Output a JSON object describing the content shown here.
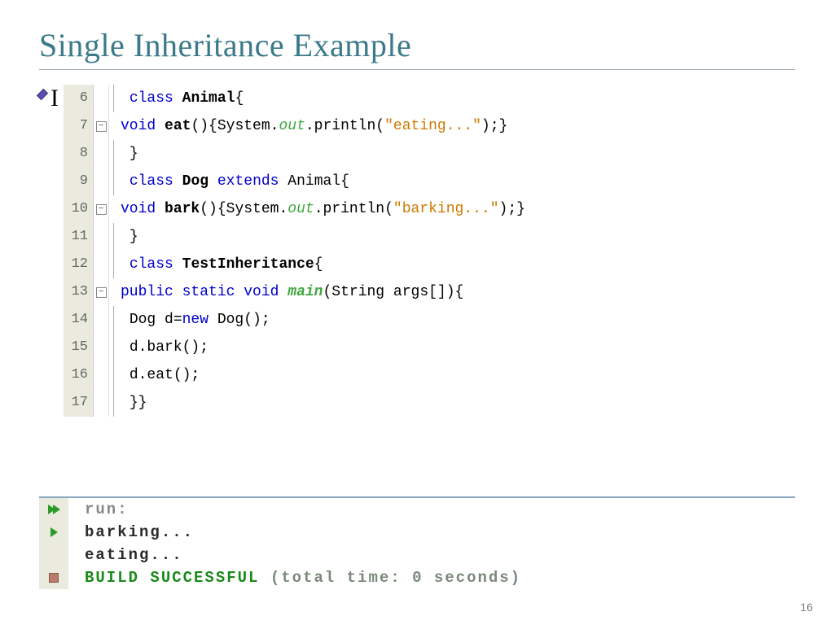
{
  "slide": {
    "title": "Single Inheritance Example",
    "bullet_letter": "I",
    "page_number": "16"
  },
  "code": {
    "lines": [
      {
        "n": "6",
        "fold": "",
        "indent": true,
        "tokens": [
          [
            "kw",
            "class"
          ],
          [
            "",
            " "
          ],
          [
            "bold",
            "Animal"
          ],
          [
            "",
            "{"
          ]
        ]
      },
      {
        "n": "7",
        "fold": "-",
        "indent": false,
        "tokens": [
          [
            "kw",
            "void"
          ],
          [
            "",
            " "
          ],
          [
            "bold",
            "eat"
          ],
          [
            "",
            "(){System."
          ],
          [
            "it",
            "out"
          ],
          [
            "",
            ".println("
          ],
          [
            "str",
            "\"eating...\""
          ],
          [
            "",
            ");}"
          ]
        ]
      },
      {
        "n": "8",
        "fold": "",
        "indent": true,
        "tokens": [
          [
            "",
            "}"
          ]
        ]
      },
      {
        "n": "9",
        "fold": "",
        "indent": true,
        "tokens": [
          [
            "kw",
            "class"
          ],
          [
            "",
            " "
          ],
          [
            "bold",
            "Dog"
          ],
          [
            "",
            " "
          ],
          [
            "kw",
            "extends"
          ],
          [
            "",
            " Animal{"
          ]
        ]
      },
      {
        "n": "10",
        "fold": "-",
        "indent": false,
        "tokens": [
          [
            "kw",
            "void"
          ],
          [
            "",
            " "
          ],
          [
            "bold",
            "bark"
          ],
          [
            "",
            "(){System."
          ],
          [
            "it",
            "out"
          ],
          [
            "",
            ".println("
          ],
          [
            "str",
            "\"barking...\""
          ],
          [
            "",
            ");}"
          ]
        ]
      },
      {
        "n": "11",
        "fold": "",
        "indent": true,
        "tokens": [
          [
            "",
            "}"
          ]
        ]
      },
      {
        "n": "12",
        "fold": "",
        "indent": true,
        "tokens": [
          [
            "kw",
            "class"
          ],
          [
            "",
            " "
          ],
          [
            "bold",
            "TestInheritance"
          ],
          [
            "",
            "{"
          ]
        ]
      },
      {
        "n": "13",
        "fold": "-",
        "indent": false,
        "tokens": [
          [
            "kw",
            "public"
          ],
          [
            "",
            " "
          ],
          [
            "kw",
            "static"
          ],
          [
            "",
            " "
          ],
          [
            "kw",
            "void"
          ],
          [
            "",
            " "
          ],
          [
            "bold it",
            "main"
          ],
          [
            "",
            "(String args[]){"
          ]
        ]
      },
      {
        "n": "14",
        "fold": "",
        "indent": true,
        "tokens": [
          [
            "",
            "Dog d="
          ],
          [
            "kw",
            "new"
          ],
          [
            "",
            " Dog();"
          ]
        ]
      },
      {
        "n": "15",
        "fold": "",
        "indent": true,
        "tokens": [
          [
            "",
            "d.bark();"
          ]
        ]
      },
      {
        "n": "16",
        "fold": "",
        "indent": true,
        "tokens": [
          [
            "",
            "d.eat();"
          ]
        ]
      },
      {
        "n": "17",
        "fold": "",
        "indent": true,
        "tokens": [
          [
            "",
            "}}"
          ]
        ]
      }
    ]
  },
  "output": {
    "rows": [
      {
        "icon": "run-double",
        "cls": "run-label",
        "text": "run:"
      },
      {
        "icon": "run",
        "cls": "out-black",
        "text": "barking..."
      },
      {
        "icon": "",
        "cls": "out-black",
        "text": "eating..."
      },
      {
        "icon": "stop",
        "build_ok": "BUILD SUCCESSFUL",
        "build_rest": " (total time: 0 seconds)"
      }
    ]
  }
}
